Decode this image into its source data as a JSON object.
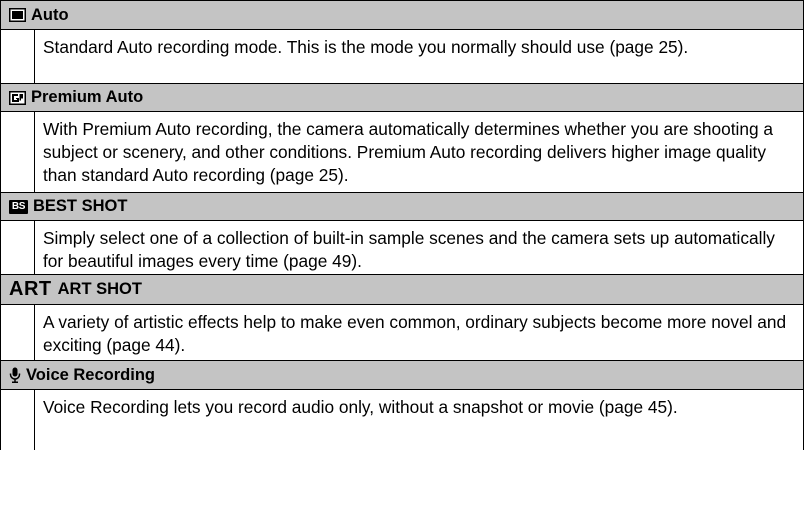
{
  "modes": [
    {
      "title": "Auto",
      "icon": "auto-mode-icon",
      "description": "Standard Auto recording mode. This is the mode you normally should use (page 25)."
    },
    {
      "title": "Premium Auto",
      "icon": "premium-auto-icon",
      "description": "With Premium Auto recording, the camera automatically determines whether you are shooting a subject or scenery, and other conditions. Premium Auto recording delivers higher image quality than standard Auto recording (page 25)."
    },
    {
      "title": "BEST SHOT",
      "icon": "best-shot-icon",
      "icon_text": "BS",
      "description": "Simply select one of a collection of built-in sample scenes and the camera sets up automatically for beautiful images every time (page 49)."
    },
    {
      "title": "ART SHOT",
      "icon": "art-shot-icon",
      "icon_text": "ART",
      "description": "A variety of artistic effects help to make even common, ordinary subjects become more novel and exciting (page 44)."
    },
    {
      "title": "Voice Recording",
      "icon": "microphone-icon",
      "description": "Voice Recording lets you record audio only, without a snapshot or movie (page 45)."
    }
  ]
}
